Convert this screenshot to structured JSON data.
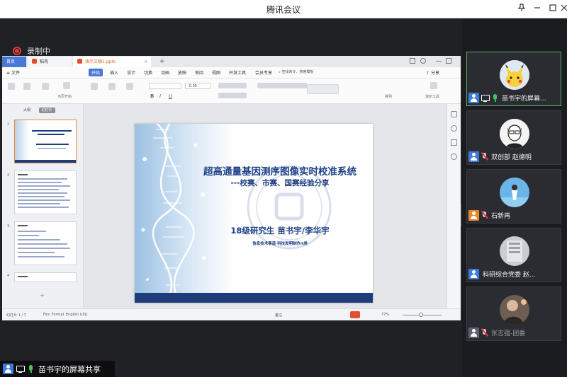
{
  "window": {
    "title": "腾讯会议"
  },
  "recording": {
    "label": "录制中"
  },
  "wps": {
    "tabs": [
      "首页",
      "稻壳",
      "演示文稿1.pptx"
    ],
    "menu": {
      "file": "文件",
      "items": [
        "开始",
        "插入",
        "设计",
        "切换",
        "动画",
        "放映",
        "审阅",
        "视图",
        "开发工具",
        "会员专享"
      ],
      "search": "查找命令、搜索模板",
      "share": "分享"
    },
    "toolbar": {
      "font_size": "-0.05",
      "labels": [
        "当页开始",
        "排列",
        "演示工具"
      ]
    },
    "sidebar": {
      "tabs": [
        "大纲",
        "幻灯片"
      ],
      "thumb_numbers": [
        "1",
        "2",
        "3",
        "4"
      ]
    },
    "slide": {
      "title": "超高通量基因测序图像实时校准系统",
      "subtitle": "---校赛、市赛、国赛经验分享",
      "author": "18级研究生 苗书宇/李华宇",
      "dept": "信息技术事道·科技发明制作A类"
    },
    "status": {
      "slide_count": "幻灯片 1 / 7",
      "theme": "Finn Format",
      "lang": "English (US)",
      "notes": "备注",
      "zoom": "77%"
    }
  },
  "presenter": {
    "label": "苗书宇的屏幕共享"
  },
  "participants": [
    {
      "name": "苗书宇的屏幕...",
      "badge": "blue",
      "sharing": true,
      "mic": "on"
    },
    {
      "name": "双创部 赵德明",
      "badge": "blue",
      "sharing": false,
      "mic": "off"
    },
    {
      "name": "石新再",
      "badge": "orange",
      "sharing": false,
      "mic": "off"
    },
    {
      "name": "科研综合党委 赵...",
      "badge": "blue",
      "sharing": false,
      "mic": "none"
    },
    {
      "name": "张志强-团委",
      "badge": "gray",
      "sharing": false,
      "mic": "off"
    }
  ],
  "colors": {
    "accent_blue": "#4a78d6",
    "slide_text": "#1d3f85",
    "record_red": "#e23a3a",
    "mic_green": "#3fc55b",
    "speaking_border": "#58b06a"
  }
}
